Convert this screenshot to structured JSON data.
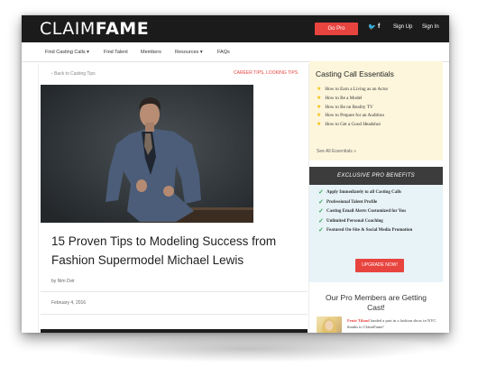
{
  "header": {
    "logo_light": "CLAIM",
    "logo_bold": "FAME",
    "go_pro": "Go Pro",
    "twitter_icon": "twitter-icon",
    "facebook_icon": "facebook-icon",
    "twitter_glyph": "🐦",
    "facebook_glyph": "f",
    "sign_up": "Sign Up",
    "sign_in": "Sign In"
  },
  "nav": {
    "items": [
      "Find Casting Calls ▾",
      "Find Talent",
      "Members",
      "Resources ▾",
      "FAQs"
    ]
  },
  "article": {
    "back_link": "‹ Back to Casting Tips",
    "categories": "CAREER TIPS, LOOKING TIPS",
    "headline": "15 Proven Tips to Modeling Success from Fashion Supermodel Michael Lewis",
    "byline": "by Nim Dvir",
    "date": "February 4, 2016"
  },
  "sidebar": {
    "essentials_title": "Casting Call Essentials",
    "essentials": [
      "How to Earn a Living as an Actor",
      "How to Be a Model",
      "How to Be on Reality TV",
      "How to Prepare for an Audition",
      "How to Get a Good Headshot"
    ],
    "see_all": "See All Essentials »",
    "pro_title": "EXCLUSIVE PRO BENEFITS",
    "pro_benefits": [
      "Apply Immediately to all Casting Calls",
      "Professional Talent Profile",
      "Casting Email Alerts Customized for You",
      "Unlimited Personal Coaching",
      "Featured On-Site & Social Media Promotion"
    ],
    "upgrade": "UPGRADE NOW!",
    "cast_title": "Our Pro Members are Getting Cast!",
    "cast_name": "Fenie Tiland",
    "cast_text": " landed a part in a fashion show in NYC thanks to ClaimFame!"
  },
  "colors": {
    "accent": "#e8443f",
    "topbar": "#1b1b1b",
    "essentials_bg": "#fdf6dc",
    "pro_bg": "#e7f3f7"
  }
}
